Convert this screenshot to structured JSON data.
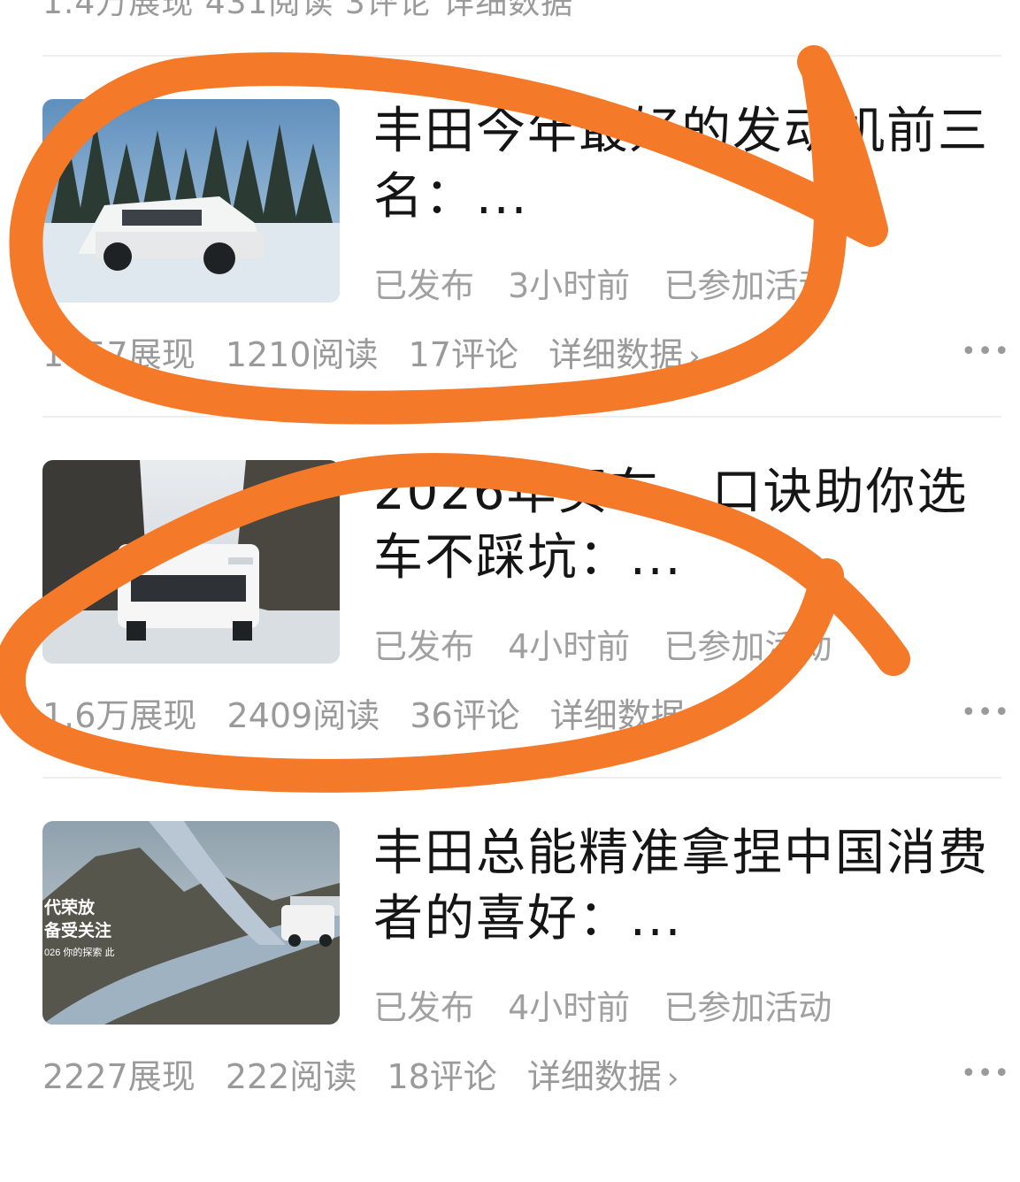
{
  "top_cropped_stats": "1.4万展现  431阅读  3评论  详细数据",
  "articles": [
    {
      "title": "丰田今年最好的发动机前三名：...",
      "status": "已发布",
      "time": "3小时前",
      "activity": "已参加活动",
      "impressions": "1957展现",
      "reads": "1210阅读",
      "comments": "17评论",
      "detail": "详细数据"
    },
    {
      "title": "2026年买车，口诀助你选车不踩坑：...",
      "status": "已发布",
      "time": "4小时前",
      "activity": "已参加活动",
      "impressions": "1.6万展现",
      "reads": "2409阅读",
      "comments": "36评论",
      "detail": "详细数据"
    },
    {
      "title": "丰田总能精准拿捏中国消费者的喜好：...",
      "status": "已发布",
      "time": "4小时前",
      "activity": "已参加活动",
      "impressions": "2227展现",
      "reads": "222阅读",
      "comments": "18评论",
      "detail": "详细数据"
    }
  ],
  "thumb3_text": {
    "line1": "代荣放",
    "line2": "备受关注",
    "line3": "026 你的探索 此"
  },
  "more_icon": "more-horizontal-icon",
  "chevron_icon": "chevron-right-icon",
  "annotation_color": "#F47A2A"
}
